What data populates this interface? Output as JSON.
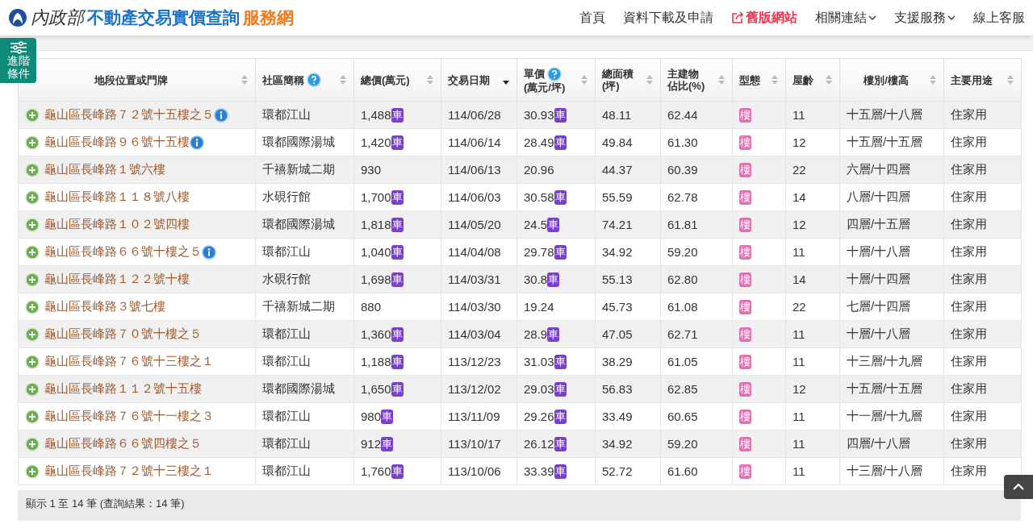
{
  "header": {
    "logo": {
      "ministry": "內政部",
      "title": "不動產交易實價查詢",
      "suffix": "服務網"
    },
    "nav": [
      {
        "label": "首頁",
        "kind": "plain"
      },
      {
        "label": "資料下載及申請",
        "kind": "plain"
      },
      {
        "label": "舊版網站",
        "kind": "external"
      },
      {
        "label": "相關連結",
        "kind": "dropdown"
      },
      {
        "label": "支援服務",
        "kind": "dropdown"
      },
      {
        "label": "線上客服",
        "kind": "plain"
      }
    ]
  },
  "filter_button": {
    "label": "進階條件"
  },
  "table": {
    "columns": [
      {
        "label": [
          "地段位置或門牌"
        ],
        "help": false,
        "sorted": false
      },
      {
        "label": [
          "社區簡稱"
        ],
        "help": true,
        "sorted": false
      },
      {
        "label": [
          "總價(萬元)"
        ],
        "help": false,
        "sorted": false
      },
      {
        "label": [
          "交易日期"
        ],
        "help": false,
        "sorted": true
      },
      {
        "label": [
          "單價",
          "(萬元/坪)"
        ],
        "help": true,
        "sorted": false
      },
      {
        "label": [
          "總面積",
          "(坪)"
        ],
        "help": false,
        "sorted": false
      },
      {
        "label": [
          "主建物",
          "佔比(%)"
        ],
        "help": false,
        "sorted": false
      },
      {
        "label": [
          "型態"
        ],
        "help": false,
        "sorted": false
      },
      {
        "label": [
          "屋齡"
        ],
        "help": false,
        "sorted": false
      },
      {
        "label": [
          "樓別/樓高"
        ],
        "help": false,
        "sorted": false
      },
      {
        "label": [
          "主要用途"
        ],
        "help": false,
        "sorted": false
      }
    ],
    "rows": [
      {
        "address": "龜山區長峰路７２號十五樓之５",
        "info": true,
        "community": "環都江山",
        "total": {
          "value": "1,488",
          "badge": "車"
        },
        "date": "114/06/28",
        "unit": {
          "value": "30.93",
          "badge": "車"
        },
        "area": "48.11",
        "main_ratio": "62.44",
        "type": "樓",
        "age": "11",
        "floor": "十五層/十八層",
        "use": "住家用"
      },
      {
        "address": "龜山區長峰路９６號十五樓",
        "info": true,
        "community": "環都國際湯城",
        "total": {
          "value": "1,420",
          "badge": "車"
        },
        "date": "114/06/14",
        "unit": {
          "value": "28.49",
          "badge": "車"
        },
        "area": "49.84",
        "main_ratio": "61.30",
        "type": "樓",
        "age": "12",
        "floor": "十五層/十五層",
        "use": "住家用"
      },
      {
        "address": "龜山區長峰路１號六樓",
        "info": false,
        "community": "千禧新城二期",
        "total": {
          "value": "930"
        },
        "date": "114/06/13",
        "unit": {
          "value": "20.96"
        },
        "area": "44.37",
        "main_ratio": "60.39",
        "type": "樓",
        "age": "22",
        "floor": "六層/十四層",
        "use": "住家用"
      },
      {
        "address": "龜山區長峰路１１８號八樓",
        "info": false,
        "community": "水硯行館",
        "total": {
          "value": "1,700",
          "badge": "車"
        },
        "date": "114/06/03",
        "unit": {
          "value": "30.58",
          "badge": "車"
        },
        "area": "55.59",
        "main_ratio": "62.78",
        "type": "樓",
        "age": "14",
        "floor": "八層/十四層",
        "use": "住家用"
      },
      {
        "address": "龜山區長峰路１０２號四樓",
        "info": false,
        "community": "環都國際湯城",
        "total": {
          "value": "1,818",
          "badge": "車"
        },
        "date": "114/05/20",
        "unit": {
          "value": "24.5",
          "badge": "車"
        },
        "area": "74.21",
        "main_ratio": "61.81",
        "type": "樓",
        "age": "12",
        "floor": "四層/十五層",
        "use": "住家用"
      },
      {
        "address": "龜山區長峰路６６號十樓之５",
        "info": true,
        "community": "環都江山",
        "total": {
          "value": "1,040",
          "badge": "車"
        },
        "date": "114/04/08",
        "unit": {
          "value": "29.78",
          "badge": "車"
        },
        "area": "34.92",
        "main_ratio": "59.20",
        "type": "樓",
        "age": "11",
        "floor": "十層/十八層",
        "use": "住家用"
      },
      {
        "address": "龜山區長峰路１２２號十樓",
        "info": false,
        "community": "水硯行館",
        "total": {
          "value": "1,698",
          "badge": "車"
        },
        "date": "114/03/31",
        "unit": {
          "value": "30.8",
          "badge": "車"
        },
        "area": "55.13",
        "main_ratio": "62.80",
        "type": "樓",
        "age": "14",
        "floor": "十層/十四層",
        "use": "住家用"
      },
      {
        "address": "龜山區長峰路３號七樓",
        "info": false,
        "community": "千禧新城二期",
        "total": {
          "value": "880"
        },
        "date": "114/03/30",
        "unit": {
          "value": "19.24"
        },
        "area": "45.73",
        "main_ratio": "61.08",
        "type": "樓",
        "age": "22",
        "floor": "七層/十四層",
        "use": "住家用"
      },
      {
        "address": "龜山區長峰路７０號十樓之５",
        "info": false,
        "community": "環都江山",
        "total": {
          "value": "1,360",
          "badge": "車"
        },
        "date": "114/03/04",
        "unit": {
          "value": "28.9",
          "badge": "車"
        },
        "area": "47.05",
        "main_ratio": "62.71",
        "type": "樓",
        "age": "11",
        "floor": "十層/十八層",
        "use": "住家用"
      },
      {
        "address": "龜山區長峰路７６號十三樓之１",
        "info": false,
        "community": "環都江山",
        "total": {
          "value": "1,188",
          "badge": "車"
        },
        "date": "113/12/23",
        "unit": {
          "value": "31.03",
          "badge": "車"
        },
        "area": "38.29",
        "main_ratio": "61.05",
        "type": "樓",
        "age": "11",
        "floor": "十三層/十九層",
        "use": "住家用"
      },
      {
        "address": "龜山區長峰路１１２號十五樓",
        "info": false,
        "community": "環都國際湯城",
        "total": {
          "value": "1,650",
          "badge": "車"
        },
        "date": "113/12/02",
        "unit": {
          "value": "29.03",
          "badge": "車"
        },
        "area": "56.83",
        "main_ratio": "62.85",
        "type": "樓",
        "age": "12",
        "floor": "十五層/十五層",
        "use": "住家用"
      },
      {
        "address": "龜山區長峰路７６號十一樓之３",
        "info": false,
        "community": "環都江山",
        "total": {
          "value": "980",
          "badge": "車"
        },
        "date": "113/11/09",
        "unit": {
          "value": "29.26",
          "badge": "車"
        },
        "area": "33.49",
        "main_ratio": "60.65",
        "type": "樓",
        "age": "11",
        "floor": "十一層/十九層",
        "use": "住家用"
      },
      {
        "address": "龜山區長峰路６６號四樓之５",
        "info": false,
        "community": "環都江山",
        "total": {
          "value": "912",
          "badge": "車"
        },
        "date": "113/10/17",
        "unit": {
          "value": "26.12",
          "badge": "車"
        },
        "area": "34.92",
        "main_ratio": "59.20",
        "type": "樓",
        "age": "11",
        "floor": "四層/十八層",
        "use": "住家用"
      },
      {
        "address": "龜山區長峰路７２號十三樓之１",
        "info": false,
        "community": "環都江山",
        "total": {
          "value": "1,760",
          "badge": "車"
        },
        "date": "113/10/06",
        "unit": {
          "value": "33.39",
          "badge": "車"
        },
        "area": "52.72",
        "main_ratio": "61.60",
        "type": "樓",
        "age": "11",
        "floor": "十三層/十八層",
        "use": "住家用"
      }
    ]
  },
  "footer": {
    "summary": "顯示 1 至 14 筆 (查詢結果：14 筆)"
  }
}
